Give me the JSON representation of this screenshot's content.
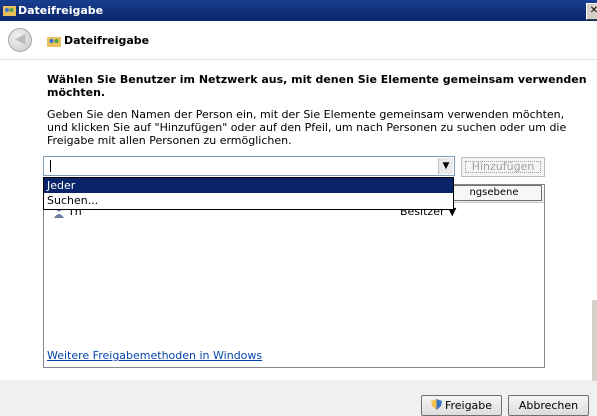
{
  "window": {
    "title": "Dateifreigabe",
    "close_glyph": "✕"
  },
  "header": {
    "title": "Dateifreigabe",
    "back_glyph": "◀"
  },
  "main": {
    "heading": "Wählen Sie Benutzer im Netzwerk aus, mit denen Sie Elemente gemeinsam verwenden möchten.",
    "description": "Geben Sie den Namen der Person ein, mit der Sie Elemente gemeinsam verwenden möchten, und klicken Sie auf \"Hinzufügen\" oder auf den Pfeil, um nach Personen zu suchen oder um die Freigabe mit allen Personen zu ermöglichen.",
    "name_input": {
      "value": "",
      "dropdown_glyph": "▼"
    },
    "add_button": "Hinzufügen",
    "dropdown_options": [
      "Jeder",
      "Suchen..."
    ],
    "column_header_permission": "ngsebene",
    "users": [
      {
        "name": "Th",
        "permission": "Besitzer ▼"
      }
    ],
    "more_link": "Weitere Freigabemethoden in Windows"
  },
  "footer": {
    "share_button": "Freigabe",
    "cancel_button": "Abbrechen"
  },
  "colors": {
    "titlebar": "#0a246a",
    "selection": "#0a246a",
    "link": "#0645ad"
  },
  "icons": [
    "share-folder-icon",
    "back-arrow-icon",
    "user-icon",
    "shield-icon",
    "close-icon"
  ]
}
